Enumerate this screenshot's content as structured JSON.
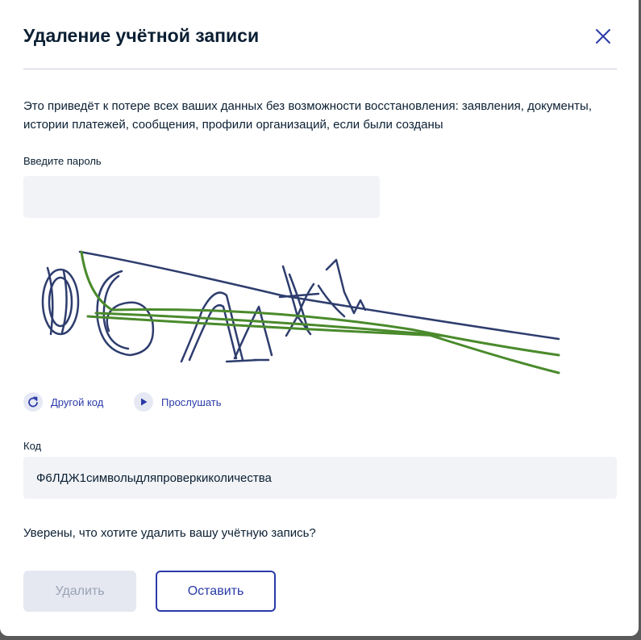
{
  "dialog": {
    "title": "Удаление учётной записи",
    "description": "Это приведёт к потере всех ваших данных без возможности восстановления: заявления, документы, истории платежей, сообщения, профили организаций, если были созданы"
  },
  "password": {
    "label": "Введите пароль",
    "value": ""
  },
  "captcha": {
    "refresh_label": "Другой код",
    "listen_label": "Прослушать",
    "refresh_icon": "refresh-icon",
    "listen_icon": "play-icon"
  },
  "code": {
    "label": "Код",
    "value": "Ф6ЛДЖ1символыдляпроверкиколичества"
  },
  "confirm": {
    "question": "Уверены, что хотите удалить вашу учётную запись?",
    "delete_label": "Удалить",
    "keep_label": "Оставить"
  },
  "colors": {
    "accent": "#2a3aa8",
    "text": "#0b1f33",
    "input_bg": "#f1f3f6",
    "captcha_blue": "#2e3d6e",
    "captcha_green": "#4a8a2c"
  }
}
